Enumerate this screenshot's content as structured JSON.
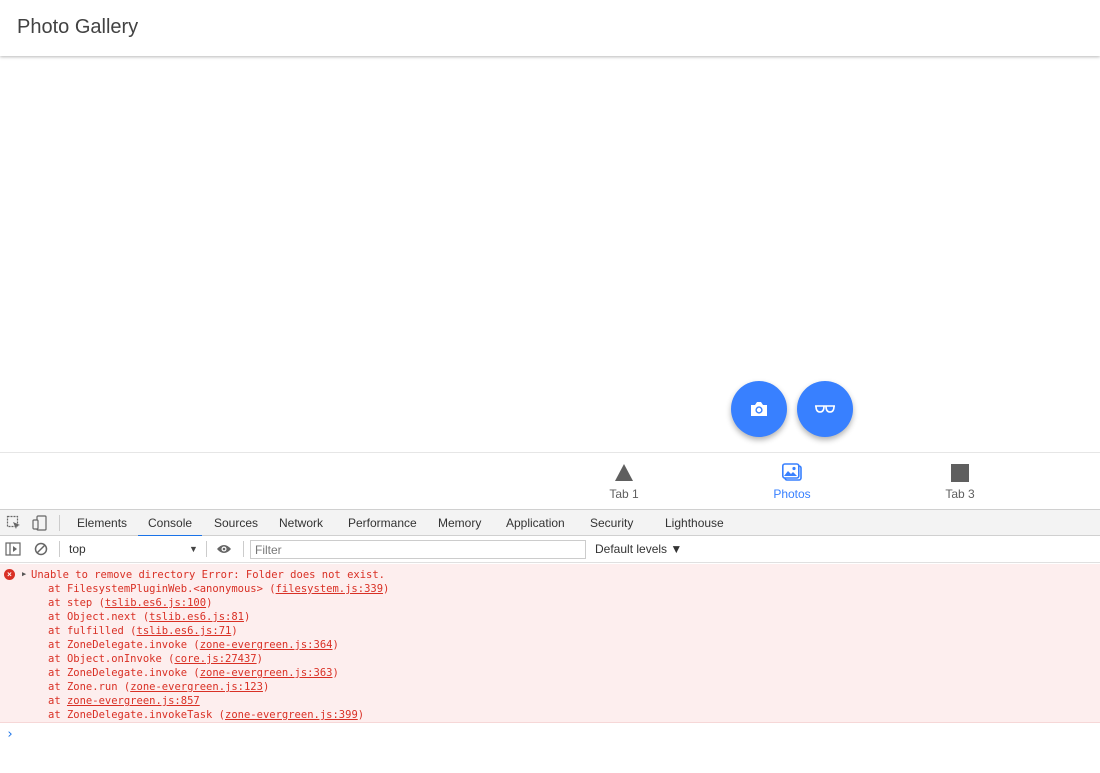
{
  "app": {
    "title": "Photo Gallery"
  },
  "fabs": {
    "camera_icon": "camera-icon",
    "glasses_icon": "glasses-icon",
    "color": "#3880ff"
  },
  "tabs": [
    {
      "label": "Tab 1",
      "icon": "triangle-icon",
      "active": false
    },
    {
      "label": "Photos",
      "icon": "images-icon",
      "active": true
    },
    {
      "label": "Tab 3",
      "icon": "square-icon",
      "active": false
    }
  ],
  "devtools": {
    "tabs": [
      "Elements",
      "Console",
      "Sources",
      "Network",
      "Performance",
      "Memory",
      "Application",
      "Security",
      "Lighthouse"
    ],
    "active_tab": "Console",
    "context": "top",
    "filter_placeholder": "Filter",
    "levels": "Default levels ▼"
  },
  "console": {
    "error_message": "Unable to remove directory Error: Folder does not exist.",
    "stack": [
      {
        "pre": "at FilesystemPluginWeb.<anonymous> (",
        "link": "filesystem.js:339",
        "post": ")"
      },
      {
        "pre": "at step (",
        "link": "tslib.es6.js:100",
        "post": ")"
      },
      {
        "pre": "at Object.next (",
        "link": "tslib.es6.js:81",
        "post": ")"
      },
      {
        "pre": "at fulfilled (",
        "link": "tslib.es6.js:71",
        "post": ")"
      },
      {
        "pre": "at ZoneDelegate.invoke (",
        "link": "zone-evergreen.js:364",
        "post": ")"
      },
      {
        "pre": "at Object.onInvoke (",
        "link": "core.js:27437",
        "post": ")"
      },
      {
        "pre": "at ZoneDelegate.invoke (",
        "link": "zone-evergreen.js:363",
        "post": ")"
      },
      {
        "pre": "at Zone.run (",
        "link": "zone-evergreen.js:123",
        "post": ")"
      },
      {
        "pre": "at ",
        "link": "zone-evergreen.js:857",
        "post": ""
      },
      {
        "pre": "at ZoneDelegate.invokeTask (",
        "link": "zone-evergreen.js:399",
        "post": ")"
      }
    ],
    "prompt": "›"
  }
}
